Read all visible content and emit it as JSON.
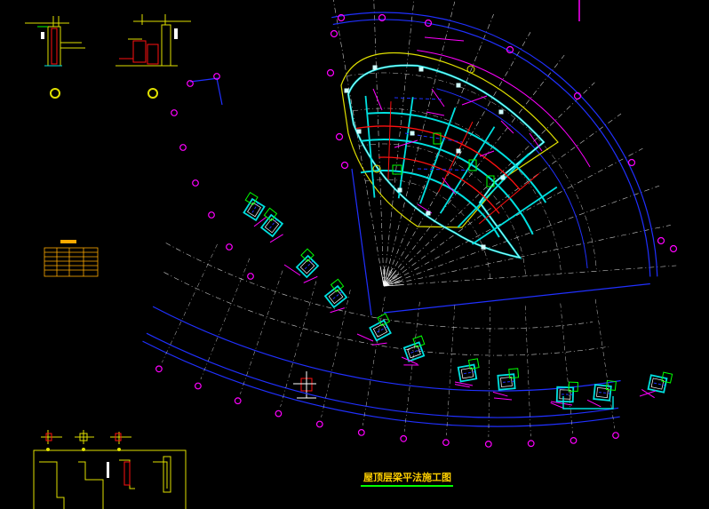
{
  "drawing": {
    "title": "屋顶层梁平法施工图",
    "colors": {
      "background": "#000000",
      "axis": "#2030ff",
      "axis_bubble": "#ff00ff",
      "beam_cyan": "#00e0e0",
      "beam_red": "#ff1010",
      "beam_magenta": "#ff00ff",
      "slab_yellow": "#e0e000",
      "dim_green": "#00ff00",
      "grid_white": "#c8c8c8",
      "detail_yellow": "#ffcc00"
    }
  }
}
